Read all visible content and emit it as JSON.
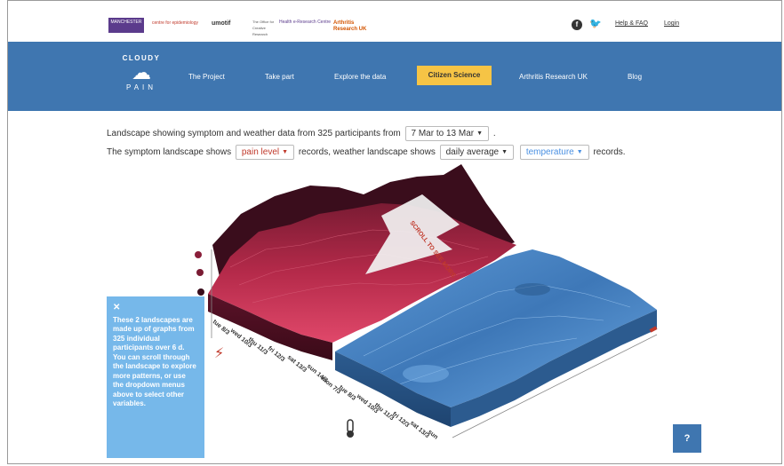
{
  "partners": {
    "manchester": "MANCHESTER",
    "epidemiology": "centre for epidemiology",
    "umotif": "umotif",
    "office_creative": "The Office for Creative Research",
    "health_research": "Health e-Research Centre",
    "arthritis": "Arthritis Research UK"
  },
  "topbar": {
    "help": "Help & FAQ",
    "login": "Login"
  },
  "brand": {
    "top": "CLOUDY",
    "bottom": "PAIN"
  },
  "nav": {
    "project": "The Project",
    "take_part": "Take part",
    "explore": "Explore the data",
    "citizen": "Citizen Science",
    "aruk": "Arthritis Research UK",
    "blog": "Blog"
  },
  "description": {
    "line1_prefix": "Landscape showing symptom and weather data from 325 participants from",
    "date_range": "7 Mar to 13 Mar",
    "line1_suffix": ".",
    "line2_prefix": "The symptom landscape shows",
    "symptom": "pain level",
    "line2_mid": "records, weather landscape shows",
    "aggregation": "daily average",
    "weather": "temperature",
    "line2_suffix": "records."
  },
  "landscape": {
    "scroll_hint": "SCROLL TO SEE MORE",
    "days": [
      "tue 8/3",
      "wed 10/3",
      "thu 11/3",
      "fri 12/3",
      "sat 13/3",
      "sun 14/3"
    ],
    "weather_days": [
      "mon 7/3",
      "tue 8/3",
      "wed 10/3",
      "thu 11/3",
      "fri 12/3",
      "sat 13/3",
      "sun"
    ],
    "colors": {
      "symptom": "#8a1f3a",
      "weather": "#3e78b8"
    }
  },
  "info": {
    "text": "These 2 landscapes are made up of graphs from 325 individual participants over 6 d. You can scroll through the landscape to explore more patterns, or use the dropdown menus above to select other variables."
  },
  "help_button": "?"
}
